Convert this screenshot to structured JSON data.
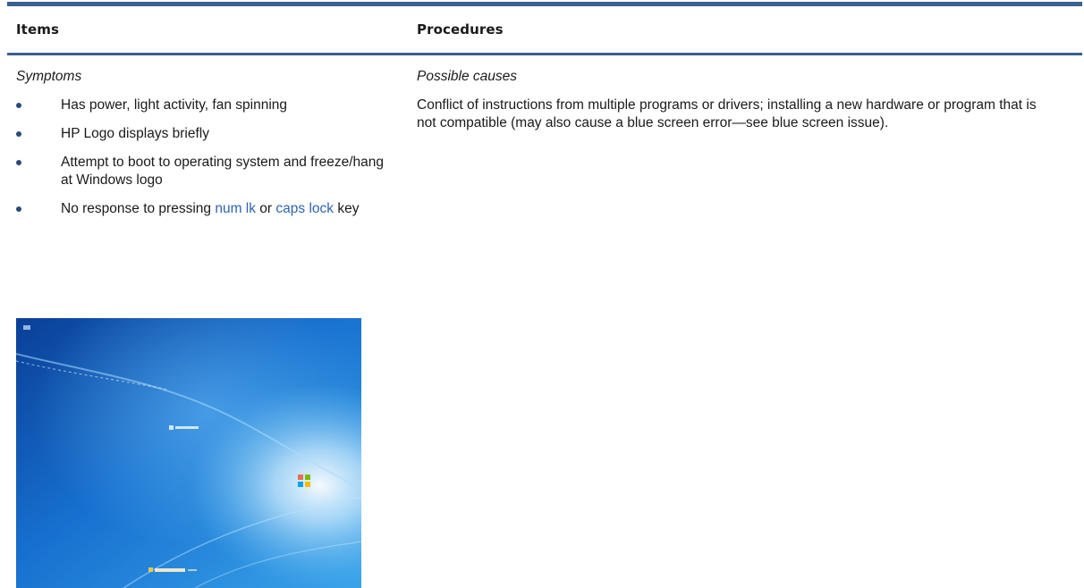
{
  "table": {
    "header": {
      "items": "Items",
      "procedures": "Procedures"
    },
    "symptoms_label": "Symptoms",
    "possible_causes_label": "Possible causes",
    "symptoms": [
      {
        "text": "Has power, light activity, fan spinning"
      },
      {
        "text": "HP Logo displays briefly"
      },
      {
        "text": "Attempt to boot to operating system and freeze/hang at Windows logo"
      },
      {
        "pre": "No response to pressing ",
        "key1": "num lk",
        "mid": " or ",
        "key2": "caps lock",
        "post": " key"
      }
    ],
    "cause": "Conflict of instructions from multiple programs or drivers; installing a new hardware or program that is not compatible (may also cause a blue screen error—see blue screen issue)."
  },
  "colors": {
    "rule": "#3a5f91",
    "key_link": "#2d64b3",
    "bullet": "#2b4a7a"
  },
  "image": {
    "description_icon": "windows-boot-screen-image"
  }
}
